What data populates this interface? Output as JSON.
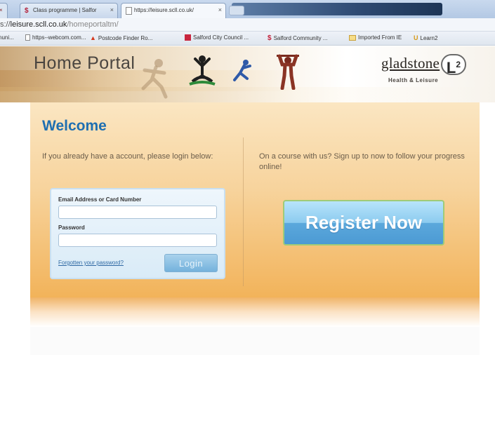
{
  "browser": {
    "tabs": [
      {
        "label": "× ",
        "icon": "s-favicon-icon"
      },
      {
        "label": "Class programme | Salfor",
        "icon": "s-favicon-icon"
      },
      {
        "label": "https://leisure.scll.co.uk/",
        "icon": "page-icon"
      }
    ],
    "address": {
      "prefix": "s://",
      "domain": "leisure.scll.co.uk",
      "path": "/homeportaltm/"
    },
    "bookmarks": [
      {
        "label": "nuni...",
        "icon": ""
      },
      {
        "label": "https--webcom.com...",
        "icon": "page-icon"
      },
      {
        "label": "Postcode Finder Ro...",
        "icon": "red-pin-icon"
      },
      {
        "label": "Salford City Council ...",
        "icon": "red-square-icon"
      },
      {
        "label": "Salford Community ...",
        "icon": "s-favicon-icon"
      },
      {
        "label": "Imported From IE",
        "icon": "folder-icon"
      },
      {
        "label": "Learn2",
        "icon": "u-favicon-icon"
      }
    ]
  },
  "header": {
    "title": "Home Portal",
    "logo_name": "gladstone",
    "logo_badge": "L",
    "logo_badge_sup": "2",
    "logo_tagline": "Health & Leisure"
  },
  "welcome": {
    "heading": "Welcome",
    "login_text": "If you already have a account, please login below:",
    "register_text": "On a course with us? Sign up to now to follow your progress online!"
  },
  "login": {
    "email_label": "Email Address or Card Number",
    "email_value": "",
    "password_label": "Password",
    "password_value": "",
    "forgot_link": "Forgotten your password?",
    "login_button": "Login"
  },
  "register": {
    "button_label": "Register Now"
  },
  "colors": {
    "heading_blue": "#1f6fb1",
    "panel_orange": "#f2b35a",
    "register_blue": "#4c9ad3"
  }
}
